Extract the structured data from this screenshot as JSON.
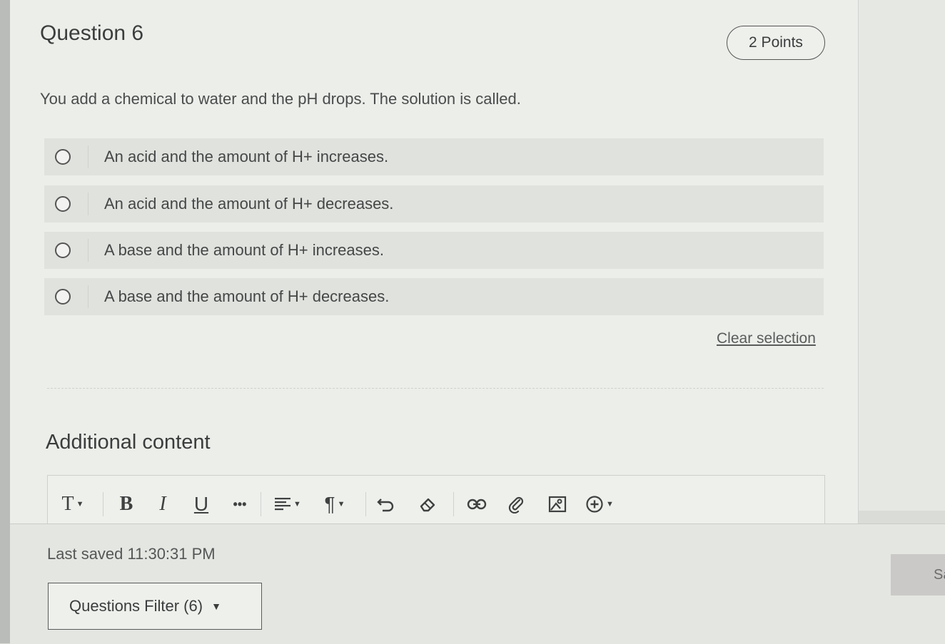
{
  "question": {
    "title": "Question 6",
    "points": "2 Points",
    "text": "You add a chemical to water and the pH drops. The solution is called.",
    "options": [
      {
        "label": "An acid and the amount of H+ increases."
      },
      {
        "label": "An acid and the amount of H+ decreases."
      },
      {
        "label": "A base and the amount of H+ increases."
      },
      {
        "label": "A base and the amount of H+ decreases."
      }
    ],
    "clear_selection": "Clear selection"
  },
  "additional": {
    "title": "Additional content",
    "toolbar": {
      "text_style": "T",
      "bold": "B",
      "italic": "I",
      "underline": "U",
      "more": "•••",
      "paragraph": "¶"
    }
  },
  "footer": {
    "last_saved": "Last saved 11:30:31 PM",
    "filter_label": "Questions Filter (6)",
    "save_label": "Sa"
  }
}
